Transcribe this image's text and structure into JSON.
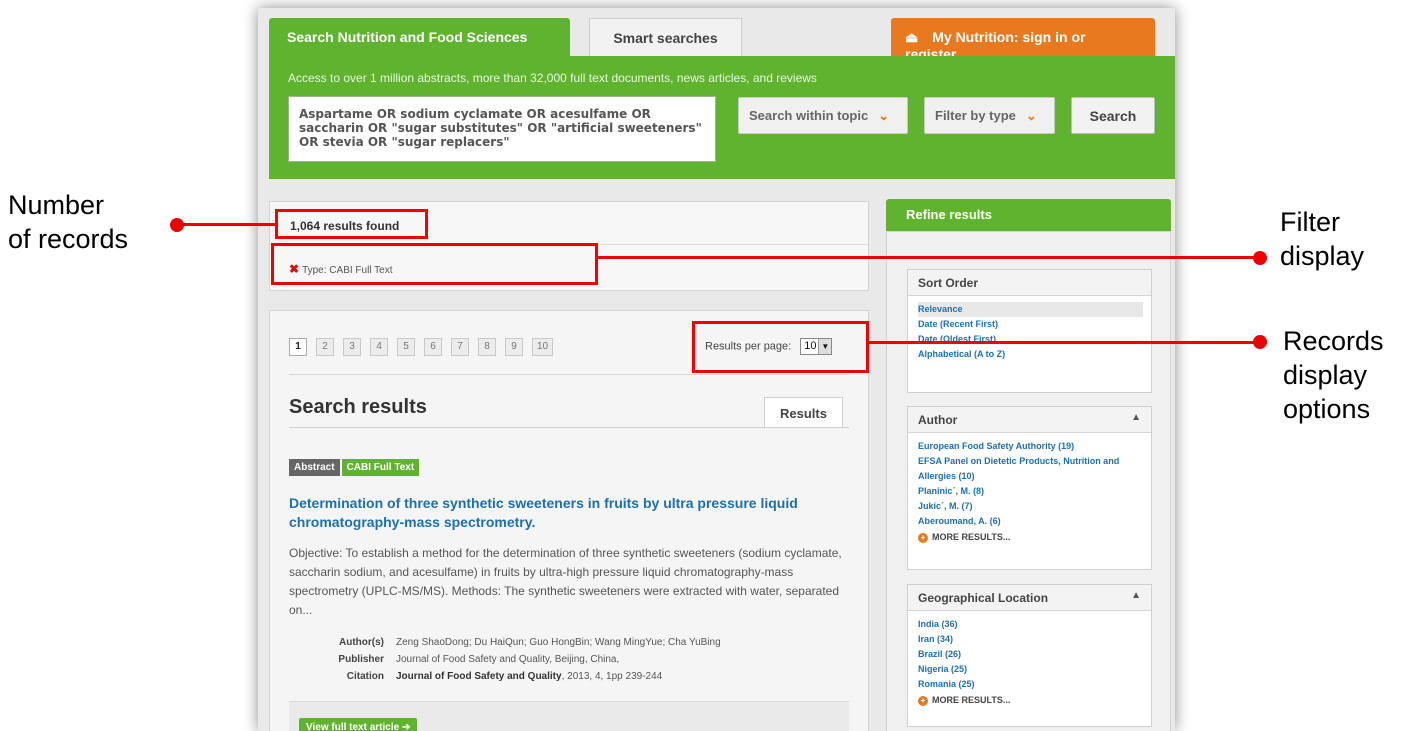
{
  "annotations": {
    "number_of_records": "Number\nof records",
    "filter_display": "Filter\ndisplay",
    "records_display_options": "Records\ndisplay\noptions"
  },
  "tabs": {
    "search_label": "Search Nutrition and Food Sciences",
    "smart_label": "Smart searches",
    "my_nutrition_label": "My Nutrition: sign in or register"
  },
  "search": {
    "intro": "Access to over 1 million abstracts, more than 32,000 full text documents, news articles, and reviews",
    "query": "Aspartame OR sodium cyclamate OR acesulfame OR saccharin OR \"sugar substitutes\" OR \"artificial sweeteners\" OR stevia OR \"sugar replacers\"",
    "topic_label": "Search within topic",
    "type_label": "Filter by type",
    "button_label": "Search"
  },
  "results": {
    "count": "1,064 results found",
    "filter": "Type: CABI Full Text"
  },
  "pagination": {
    "pages": [
      "1",
      "2",
      "3",
      "4",
      "5",
      "6",
      "7",
      "8",
      "9",
      "10"
    ],
    "per_page_label": "Results per page:",
    "per_page_value": "10"
  },
  "list": {
    "heading": "Search results",
    "tab_label": "Results"
  },
  "article": {
    "badge_abstract": "Abstract",
    "badge_fulltext": "CABI Full Text",
    "title": "Determination of three synthetic sweeteners in fruits by ultra pressure liquid chromatography-mass spectrometry.",
    "abstract": "Objective: To establish a method for the determination of three synthetic sweeteners (sodium cyclamate, saccharin sodium, and acesulfame) in fruits by ultra-high pressure liquid chromatography-mass spectrometry (UPLC-MS/MS). Methods: The synthetic sweeteners were extracted with water, separated on...",
    "authors_label": "Author(s)",
    "authors": "Zeng ShaoDong; Du HaiQun; Guo HongBin; Wang MingYue; Cha YuBing",
    "publisher_label": "Publisher",
    "publisher": "Journal of Food Safety and Quality, Beijing, China,",
    "citation_label": "Citation",
    "citation_journal": "Journal of Food Safety and Quality",
    "citation_rest": ", 2013, 4, 1pp 239-244",
    "view_button": "View full text article ➔"
  },
  "refine": {
    "heading": "Refine results",
    "sort": {
      "title": "Sort Order",
      "items": [
        "Relevance",
        "Date (Recent First)",
        "Date (Oldest First)",
        "Alphabetical (A to Z)"
      ]
    },
    "author": {
      "title": "Author",
      "items": [
        "European Food Safety Authority (19)",
        "EFSA Panel on Dietetic Products, Nutrition and Allergies (10)",
        "Planinic´, M. (8)",
        "Jukic´, M. (7)",
        "Aberoumand, A. (6)"
      ],
      "more": "MORE RESULTS..."
    },
    "geo": {
      "title": "Geographical Location",
      "items": [
        "India (36)",
        "Iran (34)",
        "Brazil (26)",
        "Nigeria (25)",
        "Romania (25)"
      ],
      "more": "MORE RESULTS..."
    }
  },
  "colors": {
    "brand_green": "#5fb32e",
    "accent_orange": "#e8791f",
    "callout_red": "#e00000",
    "link_blue": "#1f6fad"
  }
}
